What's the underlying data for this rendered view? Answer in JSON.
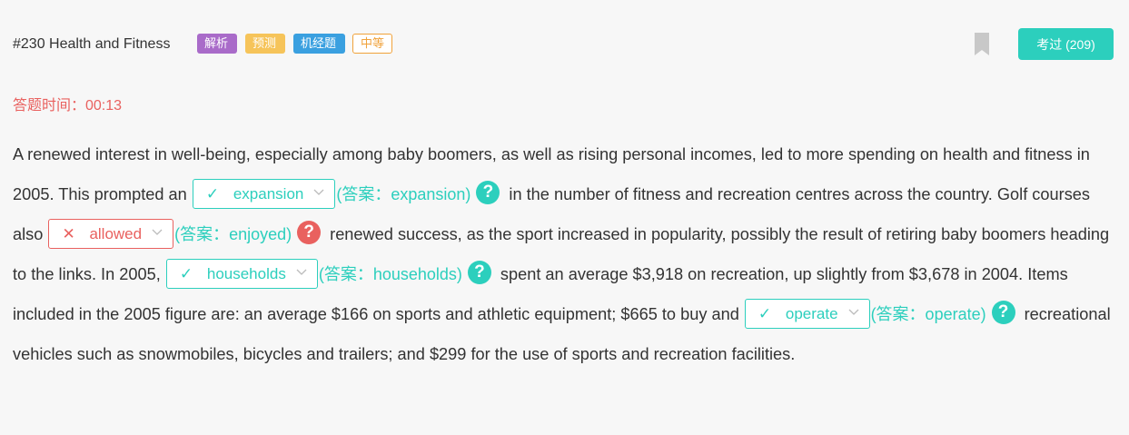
{
  "header": {
    "title": "#230 Health and Fitness",
    "tags": [
      "解析",
      "预测",
      "机经题",
      "中等"
    ],
    "done_button": "考过 (209)"
  },
  "timer": {
    "label": "答题时间：00:13"
  },
  "passage": {
    "seg0": "A renewed interest in well-being, especially among baby boomers, as well as rising personal incomes, led to more spending on health and fitness in 2005. This prompted an",
    "blank1": {
      "value": "expansion",
      "answer": "(答案：expansion)",
      "status": "correct"
    },
    "seg1": "in the number of fitness and recreation centres across the country. Golf courses also",
    "blank2": {
      "value": "allowed",
      "answer": "(答案：enjoyed)",
      "status": "wrong"
    },
    "seg2": "renewed success, as the sport increased in popularity, possibly the result of retiring baby boomers heading to the links. In 2005,",
    "blank3": {
      "value": "households",
      "answer": "(答案：households)",
      "status": "correct"
    },
    "seg3": "spent an average $3,918 on recreation, up slightly from $3,678 in 2004. Items included in the 2005 figure are: an average $166 on sports and athletic equipment; $665 to buy and",
    "blank4": {
      "value": "operate",
      "answer": "(答案：operate)",
      "status": "correct"
    },
    "seg4": "recreational vehicles such as snowmobiles, bicycles and trailers; and $299 for the use of sports and recreation facilities."
  },
  "icons": {
    "check": "check-icon",
    "cross": "cross-icon",
    "chevron": "chevron-down-icon",
    "help": "question-circle-icon",
    "bookmark": "bookmark-icon"
  },
  "colors": {
    "accent": "#2ccfbd",
    "error": "#e9615f",
    "tag_analysis": "#a96bc9",
    "tag_predict": "#f6c45a",
    "tag_jijing": "#3aa0e0",
    "tag_level": "#f0a23a"
  }
}
